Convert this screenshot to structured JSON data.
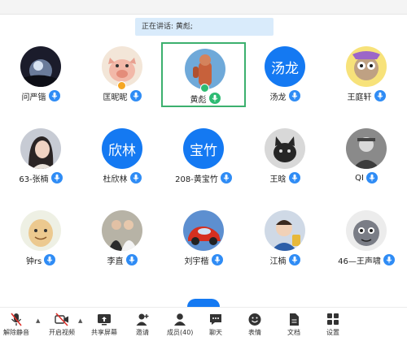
{
  "banner": {
    "speaking_text": "正在讲话: 黄彪;"
  },
  "participants": [
    {
      "name": "问严锴",
      "avatar": "photo-night-sky",
      "mic": "on"
    },
    {
      "name": "匡昵昵",
      "avatar": "photo-pig",
      "mic": "on",
      "badge": "host"
    },
    {
      "name": "黄彪",
      "avatar": "photo-figure",
      "mic": "speaking",
      "active": true,
      "badge": "speaker"
    },
    {
      "name": "汤龙",
      "avatar_text": "汤龙",
      "mic": "on"
    },
    {
      "name": "王庭轩",
      "avatar": "photo-cartoon",
      "mic": "on"
    },
    {
      "name": "63-张楠",
      "avatar": "photo-woman",
      "mic": "on"
    },
    {
      "name": "杜欣林",
      "avatar_text": "欣林",
      "mic": "on"
    },
    {
      "name": "208-黄宝竹",
      "avatar_text": "宝竹",
      "mic": "on"
    },
    {
      "name": "王晗",
      "avatar": "photo-cat",
      "mic": "on"
    },
    {
      "name": "QI",
      "avatar": "photo-man-bw",
      "mic": "on"
    },
    {
      "name": "钟rs",
      "avatar": "photo-egg-face",
      "mic": "on"
    },
    {
      "name": "李直",
      "avatar": "photo-couple",
      "mic": "on"
    },
    {
      "name": "刘宇楷",
      "avatar": "photo-cars",
      "mic": "on"
    },
    {
      "name": "江楠",
      "avatar": "photo-child",
      "mic": "on"
    },
    {
      "name": "46—王声啸",
      "avatar": "photo-cartoon-gray",
      "mic": "on"
    }
  ],
  "toolbar": {
    "unmute": "解除静音",
    "video": "开启视频",
    "share": "共享屏幕",
    "invite": "邀请",
    "members": "成员(40)",
    "chat": "聊天",
    "reactions": "表情",
    "docs": "文档",
    "settings": "设置"
  }
}
